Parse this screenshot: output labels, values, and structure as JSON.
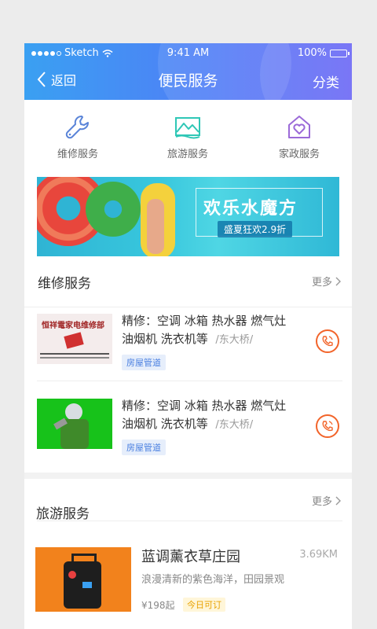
{
  "status_bar": {
    "carrier": "Sketch",
    "time": "9:41 AM",
    "battery": "100%"
  },
  "nav": {
    "back_label": "返回",
    "title": "便民服务",
    "category_label": "分类"
  },
  "services": [
    {
      "label": "维修服务",
      "icon": "wrench-icon"
    },
    {
      "label": "旅游服务",
      "icon": "mountain-icon"
    },
    {
      "label": "家政服务",
      "icon": "house-heart-icon"
    }
  ],
  "banner": {
    "title": "欢乐水魔方",
    "subtitle": "盛夏狂欢2.9折"
  },
  "repair_section": {
    "title": "维修服务",
    "more_label": "更多",
    "items": [
      {
        "line1": "精修：空调 冰箱 热水器 燃气灶",
        "line2": "油烟机 洗衣机等",
        "location": "/东大桥/",
        "tag": "房屋管道",
        "thumb_text": "恒祥電家电维修部"
      },
      {
        "line1": "精修：空调 冰箱 热水器 燃气灶",
        "line2": "油烟机 洗衣机等",
        "location": "/东大桥/",
        "tag": "房屋管道"
      }
    ]
  },
  "tour_section": {
    "title": "旅游服务",
    "more_label": "更多",
    "item": {
      "name": "蓝调薰衣草庄园",
      "distance": "3.69KM",
      "desc": "浪漫清新的紫色海洋，田园景观",
      "price": "¥198起",
      "availability": "今日可订"
    }
  },
  "colors": {
    "header_start": "#3aa0f2",
    "header_end": "#6b67f5",
    "call_orange": "#f2642a",
    "tag_blue": "#4a7fe0"
  }
}
